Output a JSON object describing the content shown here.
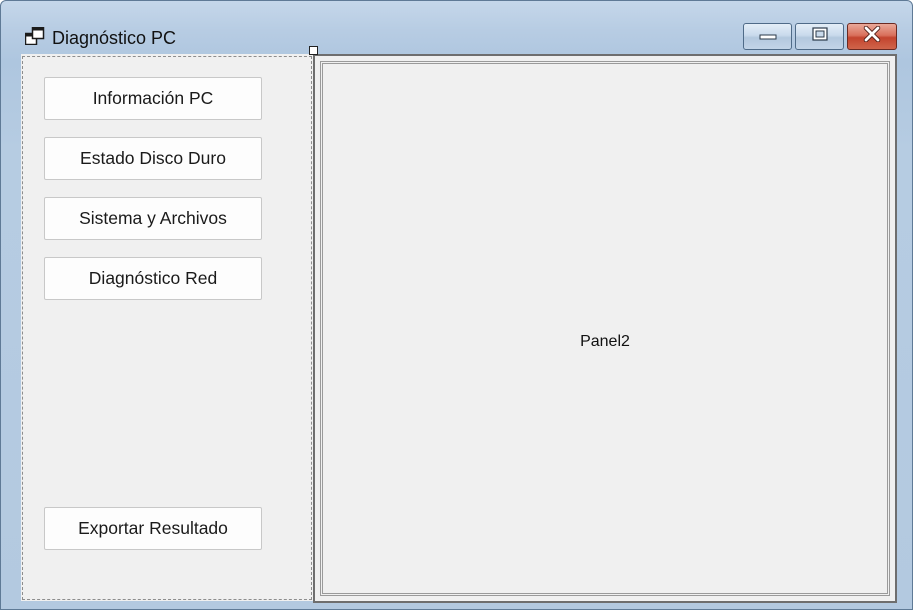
{
  "window": {
    "title": "Diagnóstico PC",
    "icon": "app-window-icon",
    "controls": {
      "minimize_icon": "minimize-icon",
      "maximize_icon": "maximize-icon",
      "close_icon": "close-icon"
    }
  },
  "sidebar": {
    "buttons": [
      {
        "label": "Información PC"
      },
      {
        "label": "Estado Disco Duro"
      },
      {
        "label": "Sistema y Archivos"
      },
      {
        "label": "Diagnóstico Red"
      }
    ],
    "export_button": {
      "label": "Exportar Resultado"
    }
  },
  "main_panel": {
    "label": "Panel2"
  },
  "colors": {
    "client_background": "#f0f0f0",
    "close_button": "#c3442e",
    "frame": "#b3c9e0"
  }
}
